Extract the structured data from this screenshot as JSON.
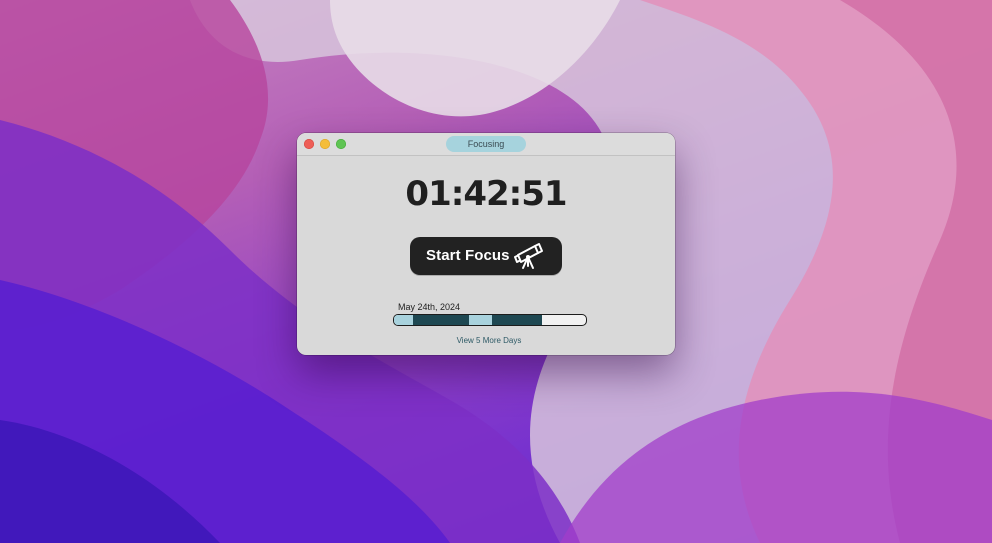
{
  "window": {
    "title": "Focusing"
  },
  "timer": {
    "display": "01:42:51"
  },
  "focus_button": {
    "label": "Start Focus",
    "icon": "telescope-icon"
  },
  "timeline": {
    "date": "May 24th, 2024",
    "segments": [
      {
        "kind": "light",
        "start": 0.0,
        "end": 0.1
      },
      {
        "kind": "dark",
        "start": 0.1,
        "end": 0.39
      },
      {
        "kind": "light",
        "start": 0.39,
        "end": 0.51
      },
      {
        "kind": "dark",
        "start": 0.51,
        "end": 0.77
      }
    ]
  },
  "more_days": {
    "label": "View 5 More Days"
  },
  "colors": {
    "accent_light": "#a8d2dd",
    "accent_dark": "#1e4852",
    "button_bg": "#222222"
  }
}
